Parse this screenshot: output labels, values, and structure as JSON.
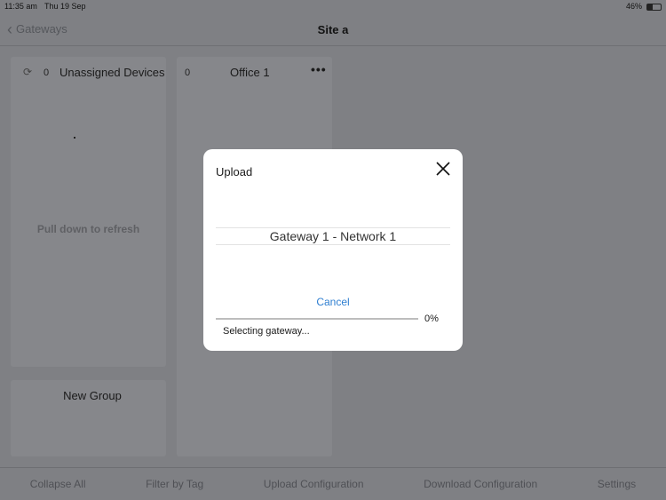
{
  "status": {
    "time": "11:35 am",
    "date": "Thu 19 Sep",
    "battery": "46%"
  },
  "nav": {
    "back_label": "Gateways",
    "title": "Site a"
  },
  "groups": [
    {
      "count": "0",
      "name": "Unassigned Devices",
      "empty_text": "Pull down to refresh"
    },
    {
      "count": "0",
      "name": "Office 1"
    }
  ],
  "new_group_label": "New Group",
  "toolbar": [
    "Collapse All",
    "Filter by Tag",
    "Upload Configuration",
    "Download Configuration",
    "Settings"
  ],
  "dialog": {
    "title": "Upload",
    "selected_gateway": "Gateway 1 - Network 1",
    "cancel_label": "Cancel",
    "progress_text": "0%",
    "progress": 0,
    "status_text": "Selecting gateway..."
  }
}
